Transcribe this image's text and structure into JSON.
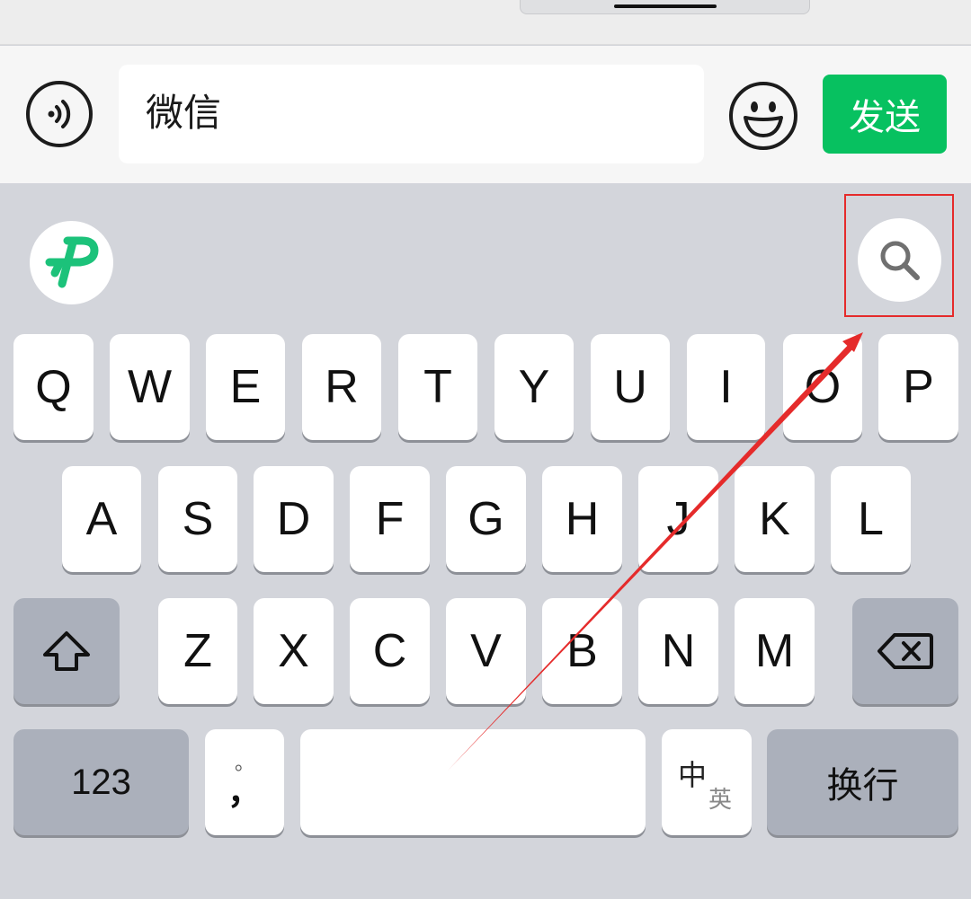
{
  "input_bar": {
    "message_text": "微信",
    "send_label": "发送"
  },
  "keyboard": {
    "row1": [
      "Q",
      "W",
      "E",
      "R",
      "T",
      "Y",
      "U",
      "I",
      "O",
      "P"
    ],
    "row2": [
      "A",
      "S",
      "D",
      "F",
      "G",
      "H",
      "J",
      "K",
      "L"
    ],
    "row3": [
      "Z",
      "X",
      "C",
      "V",
      "B",
      "N",
      "M"
    ],
    "numbers_label": "123",
    "punct_top": "。",
    "punct_bottom": "，",
    "lang_switch_primary": "中",
    "lang_switch_secondary": "英",
    "return_label": "换行"
  },
  "icons": {
    "voice": "voice-icon",
    "emoji": "emoji-icon",
    "logo": "input-method-logo-icon",
    "search": "search-icon",
    "shift": "shift-icon",
    "delete": "delete-icon"
  },
  "colors": {
    "send_button": "#07c160",
    "logo": "#1cc27a",
    "annotation": "#e52b2b"
  }
}
